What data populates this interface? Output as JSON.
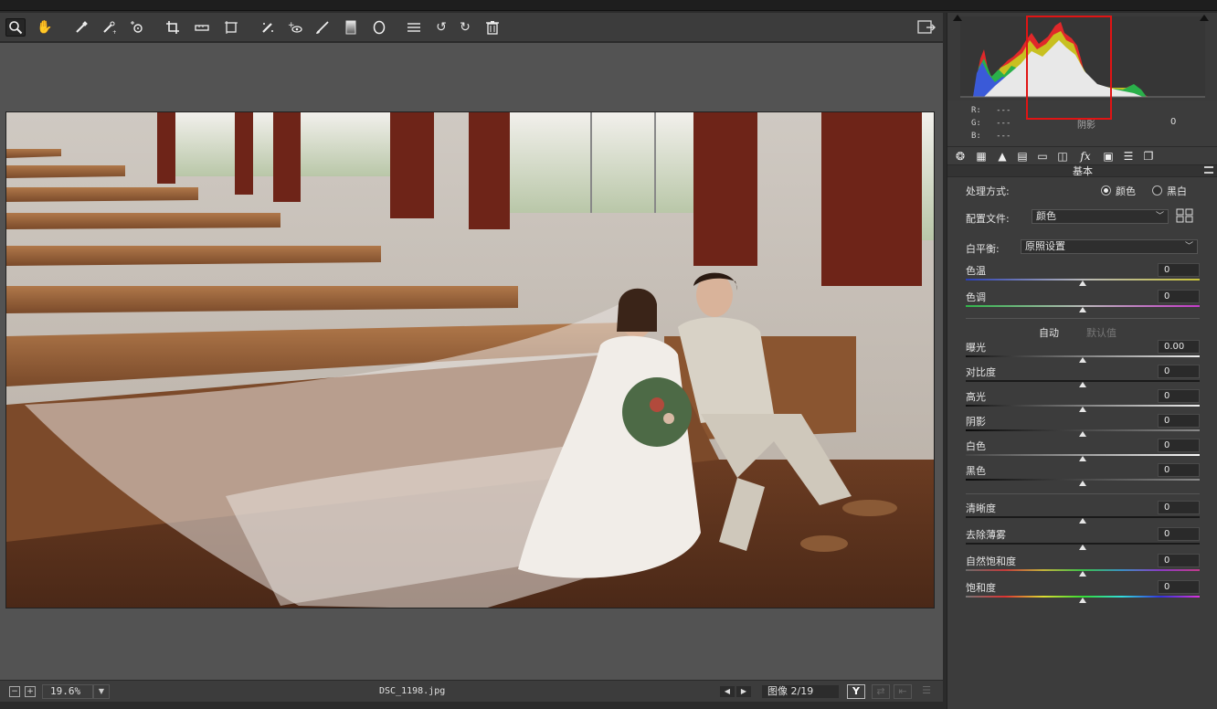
{
  "toolbar": {
    "tools": [
      "zoom-icon",
      "hand-icon",
      "white-balance-icon",
      "color-sampler-icon",
      "target-adjustment-icon",
      "crop-icon",
      "straighten-icon",
      "transform-icon",
      "spot-removal-icon",
      "red-eye-icon",
      "adjustment-brush-icon",
      "graduated-filter-icon",
      "radial-filter-icon",
      "preferences-icon",
      "rotate-left-icon",
      "rotate-right-icon",
      "trash-icon"
    ]
  },
  "histogram": {
    "r": "R:",
    "g": "G:",
    "b": "B:",
    "r_val": "---",
    "g_val": "---",
    "b_val": "---",
    "shadow_label": "阴影",
    "shadow_value": "0"
  },
  "panel": {
    "title": "基本",
    "treatment_label": "处理方式:",
    "treatment_color": "颜色",
    "treatment_bw": "黑白",
    "profile_label": "配置文件:",
    "profile_value": "颜色",
    "wb_label": "白平衡:",
    "wb_value": "原照设置",
    "auto": "自动",
    "default": "默认值",
    "sliders": [
      {
        "name": "色温",
        "value": "0",
        "level": 0.5
      },
      {
        "name": "色调",
        "value": "0",
        "level": 0.5
      },
      {
        "name": "曝光",
        "value": "0.00",
        "level": 0.5
      },
      {
        "name": "对比度",
        "value": "0",
        "level": 0.5
      },
      {
        "name": "高光",
        "value": "0",
        "level": 0.5
      },
      {
        "name": "阴影",
        "value": "0",
        "level": 0.5
      },
      {
        "name": "白色",
        "value": "0",
        "level": 0.5
      },
      {
        "name": "黑色",
        "value": "0",
        "level": 0.5
      },
      {
        "name": "清晰度",
        "value": "0",
        "level": 0.5
      },
      {
        "name": "去除薄雾",
        "value": "0",
        "level": 0.5
      },
      {
        "name": "自然饱和度",
        "value": "0",
        "level": 0.5
      },
      {
        "name": "饱和度",
        "value": "0",
        "level": 0.5
      }
    ]
  },
  "status": {
    "zoom": "19.6%",
    "filename": "DSC_1198.jpg",
    "image_count": "图像 2/19",
    "y_view": "Y"
  },
  "colors": {
    "highlight_box": "#e01414",
    "panel_bg": "#3c3c3c",
    "preview_bg": "#535353"
  }
}
